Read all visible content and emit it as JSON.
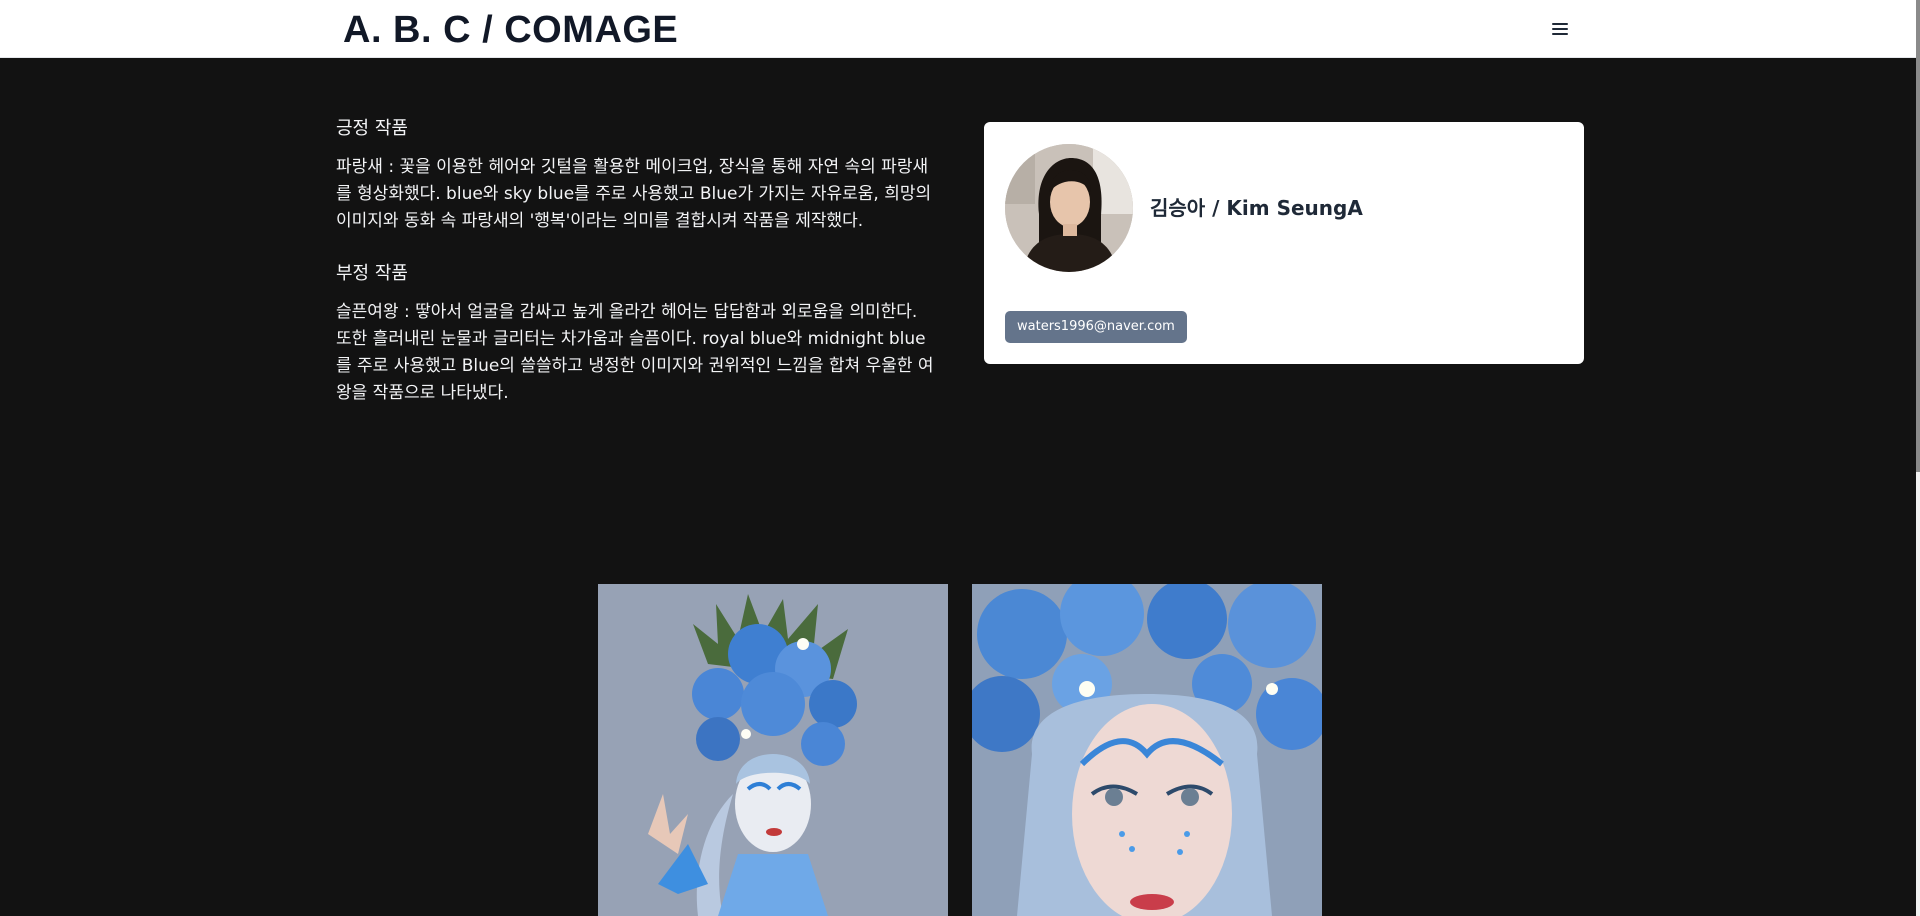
{
  "header": {
    "logo": "A. B. C / COMAGE",
    "menu_icon": "hamburger-menu-icon"
  },
  "sections": [
    {
      "title": "긍정 작품",
      "body": "파랑새 : 꽃을 이용한 헤어와 깃털을 활용한 메이크업, 장식을 통해 자연 속의 파랑새를 형상화했다. blue와 sky blue를 주로 사용했고 Blue가 가지는 자유로움, 희망의 이미지와 동화 속 파랑새의 '행복'이라는 의미를 결합시켜 작품을 제작했다."
    },
    {
      "title": "부정 작품",
      "body": "슬픈여왕 : 땋아서 얼굴을 감싸고 높게 올라간 헤어는 답답함과 외로움을 의미한다. 또한 흘러내린 눈물과 글리터는 차가움과 슬픔이다. royal blue와 midnight blue를 주로 사용했고 Blue의 쓸쓸하고 냉정한 이미지와 권위적인 느낌을 합쳐 우울한 여왕을 작품으로 나타냈다."
    }
  ],
  "profile": {
    "name": "김승아 / Kim SeungA",
    "email": "waters1996@naver.com"
  },
  "colors": {
    "page_background": "#121212",
    "card_background": "#ffffff",
    "badge_background": "#64748b"
  }
}
